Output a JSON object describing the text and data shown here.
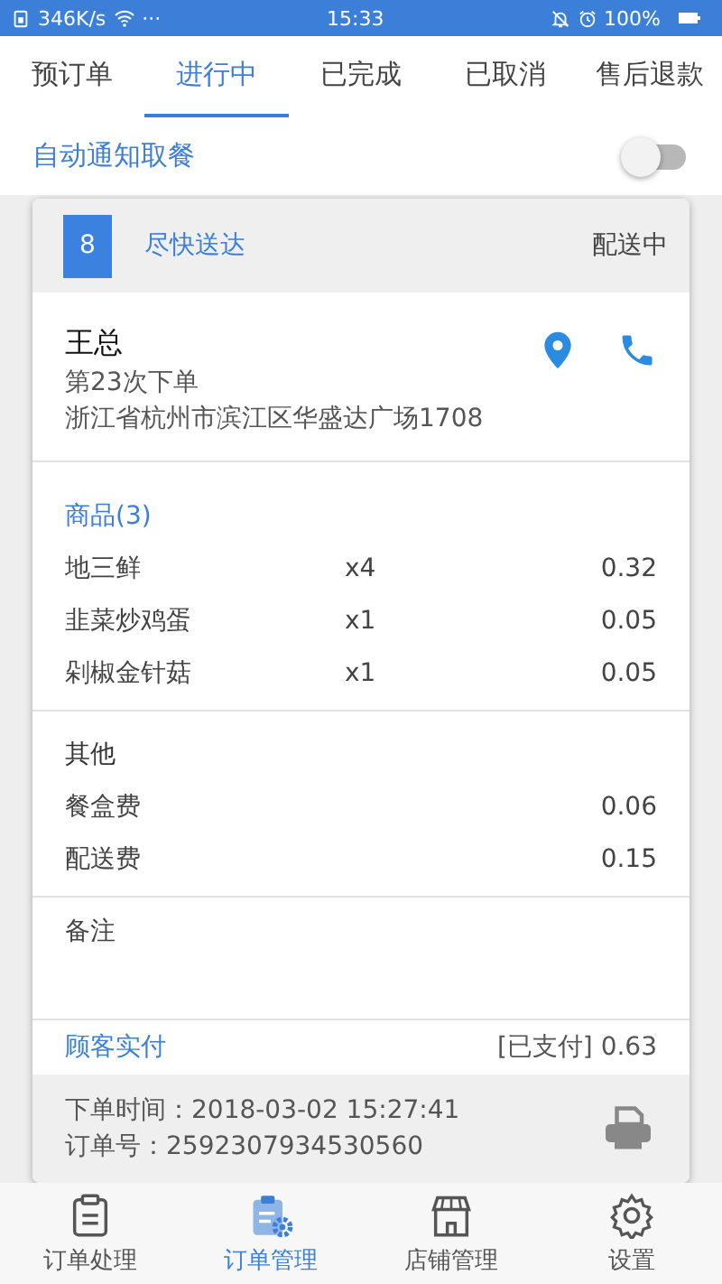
{
  "status_bar": {
    "network_speed": "346K/s",
    "more": "···",
    "time": "15:33",
    "battery": "100%"
  },
  "tabs": [
    {
      "label": "预订单",
      "selected": false
    },
    {
      "label": "进行中",
      "selected": true
    },
    {
      "label": "已完成",
      "selected": false
    },
    {
      "label": "已取消",
      "selected": false
    },
    {
      "label": "售后退款",
      "selected": false
    }
  ],
  "auto_notify": {
    "label": "自动通知取餐",
    "on": false
  },
  "order": {
    "number": "8",
    "delivery": "尽快送达",
    "status": "配送中",
    "customer": {
      "name": "王总",
      "order_count": "第23次下单",
      "address": "浙江省杭州市滨江区华盛达广场1708"
    },
    "goods": {
      "title": "商品(3)",
      "items": [
        {
          "name": "地三鲜",
          "qty": "x4",
          "price": "0.32"
        },
        {
          "name": "韭菜炒鸡蛋",
          "qty": "x1",
          "price": "0.05"
        },
        {
          "name": "剁椒金针菇",
          "qty": "x1",
          "price": "0.05"
        }
      ]
    },
    "other": {
      "title": "其他",
      "items": [
        {
          "name": "餐盒费",
          "price": "0.06"
        },
        {
          "name": "配送费",
          "price": "0.15"
        }
      ]
    },
    "note": {
      "label": "备注"
    },
    "payment": {
      "label": "顾客实付",
      "value": "[已支付] 0.63"
    },
    "order_time": "下单时间：2018-03-02 15:27:41",
    "order_no": "订单号：2592307934530560"
  },
  "bottom_nav": [
    {
      "label": "订单处理",
      "selected": false
    },
    {
      "label": "订单管理",
      "selected": true
    },
    {
      "label": "店铺管理",
      "selected": false
    },
    {
      "label": "设置",
      "selected": false
    }
  ]
}
